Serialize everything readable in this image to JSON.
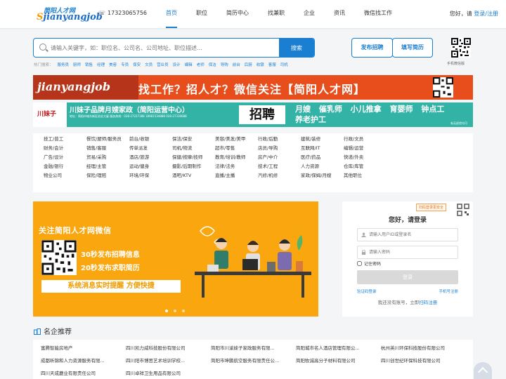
{
  "header": {
    "logo_cn": "简阳人才网",
    "logo_en_prefix": "S",
    "logo_en": "jianyangjob",
    "phone": "17323065756",
    "nav": [
      "首页",
      "职位",
      "简历中心",
      "找兼职",
      "企业",
      "资讯",
      "微信找工作"
    ],
    "greeting": "您好，请",
    "login_link": "登录/注册"
  },
  "search": {
    "placeholder": "请输入关键字，如：职位名、公司名、公司地址、职位描述...",
    "button": "搜索",
    "post_job": "发布招聘",
    "fill_resume": "填写简历",
    "qr_label": "手机微信版"
  },
  "hot": {
    "label": "热门搜索：",
    "keywords": [
      "服务员",
      "厨师",
      "销售",
      "经理",
      "美容",
      "专员",
      "保安",
      "文员",
      "营业员",
      "设计",
      "编辑",
      "老师",
      "保洁",
      "导购",
      "前台",
      "后厨",
      "收银",
      "客服",
      "司机"
    ]
  },
  "banner1": {
    "logo": "jianyangjob",
    "text": "找工作？招人才？微信关注【简阳人才网】"
  },
  "banner2": {
    "brand": "川妹子",
    "title": "川妹子品牌月嫂家政（简阳运营中心）",
    "sub": "地址：简阳市城东新区创业大厦 服务热线：028-27227388 18981534888 028-27330688",
    "hire": "招聘",
    "services": "月嫂 催乳师 小儿推拿 育婴师 钟点工 养老护工",
    "svc_sub": "有无经验均可"
  },
  "categories": [
    "技工/普工",
    "餐饮/厨师/服务员",
    "前台/收银",
    "保洁/保安",
    "美容/美发/美甲",
    "行政/后勤",
    "建筑/装修",
    "行政/文员",
    "",
    "财务/会计",
    "销售/客服",
    "传单派发",
    "司机/物流",
    "超市/零售",
    "店员/导购",
    "互联网/IT",
    "编辑/运营",
    "",
    "广告/设计",
    "贸易/采购",
    "酒店/旅游",
    "保健/按摩/技师",
    "教育/培训/教师",
    "房产/中介",
    "医疗/药品",
    "快递/外卖",
    "",
    "金融/银行",
    "经理/主管",
    "运动/健身",
    "摄影/后期制作",
    "法律/法务",
    "技术/工程",
    "人力资源",
    "仓库/库管",
    "",
    "物业公司",
    "保险/理赔",
    "环境/环保",
    "酒吧/KTV",
    "直播/主播",
    "汽修/机修",
    "家政/保姆/月嫂",
    "其他职位",
    ""
  ],
  "promo": {
    "title": "关注简阳人才网微信",
    "line1": "30秒发布招聘信息",
    "line2": "20秒发布求职简历",
    "line3": "系统消息实时提醒 方便快捷"
  },
  "login": {
    "scan_tip": "扫码登录更安全",
    "title": "您好，请登录",
    "user_placeholder": "请输入用户ID或登录名",
    "pass_placeholder": "请输入密码",
    "remember": "记住密码",
    "button": "登录",
    "code_login": "验证码登录",
    "mobile_login": "手机号注册",
    "no_account": "我还没有账号，立即",
    "scan_register": "扫码注册"
  },
  "famous": {
    "title": "名企推荐",
    "companies": [
      "富腾智能房地产",
      "四川凯力威科技股份有限公司",
      "简阳市川渝妹子家政服务有限...",
      "简阳城市名人酒店管理有限公...",
      "杭州英川环保科技股份有限公司",
      "成都昕锦和人力资源服务有限...",
      "四川阳市博思艺术培训学校...",
      "简阳市坤鹏航空服务有限责任公...",
      "简阳牧诚高分子材料有限公司",
      "四川创世纪环保科技有限公司",
      "四川天成蘑业有限责任公司",
      "四川卓祥卫生用品有限公司",
      "",
      "",
      ""
    ]
  },
  "colors": {
    "accent": "#1a7fd1",
    "banner1": "#e84d1c",
    "banner2": "#33b3a6",
    "promo": "#f9a60f"
  }
}
